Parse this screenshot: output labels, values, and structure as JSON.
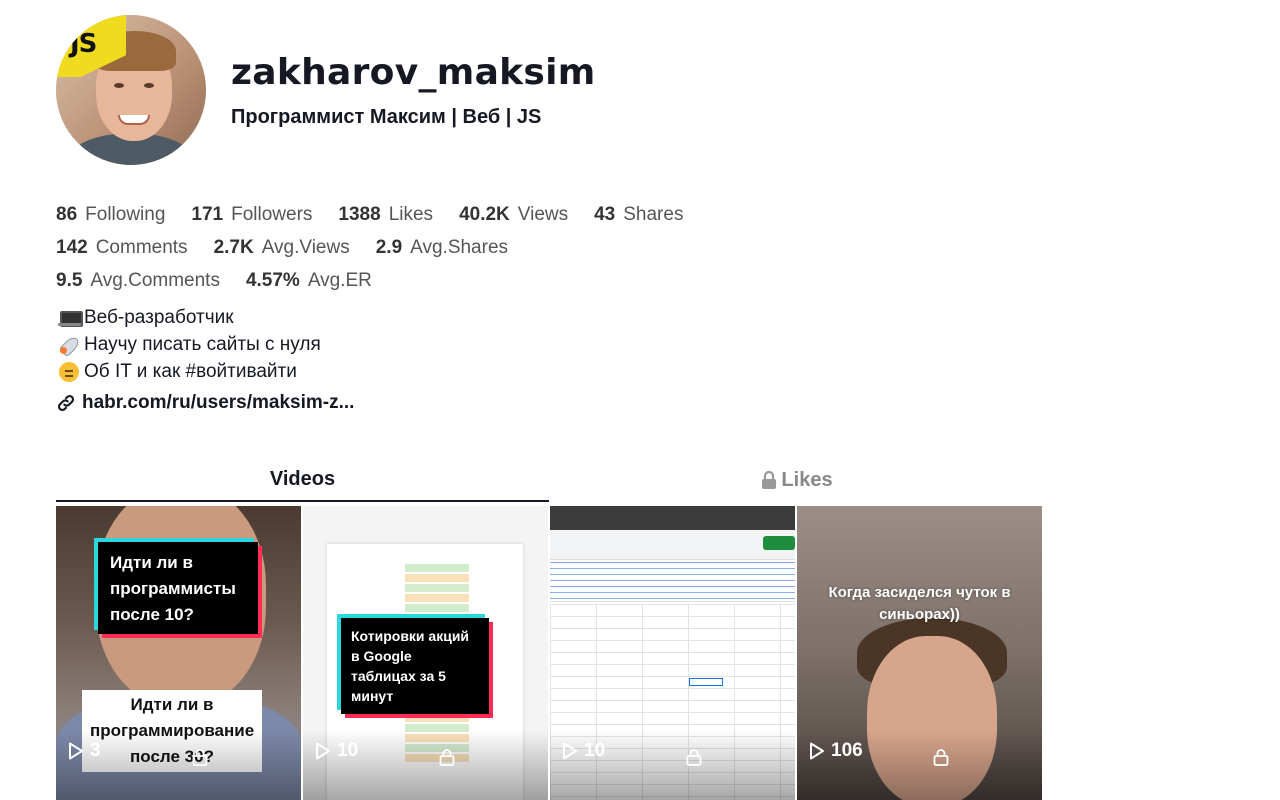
{
  "profile": {
    "username": "zakharov_maksim",
    "nickname": "Программист Максим | Веб | JS",
    "avatar_badge": "JS",
    "accent_color": "#f0db1e"
  },
  "stats": {
    "row1": [
      {
        "value": "86",
        "label": "Following"
      },
      {
        "value": "171",
        "label": "Followers"
      },
      {
        "value": "1388",
        "label": "Likes"
      },
      {
        "value": "40.2K",
        "label": "Views"
      },
      {
        "value": "43",
        "label": "Shares"
      }
    ],
    "row2": [
      {
        "value": "142",
        "label": "Comments"
      },
      {
        "value": "2.7K",
        "label": "Avg.Views"
      },
      {
        "value": "2.9",
        "label": "Avg.Shares"
      }
    ],
    "row3": [
      {
        "value": "9.5",
        "label": "Avg.Comments"
      },
      {
        "value": "4.57%",
        "label": "Avg.ER"
      }
    ]
  },
  "bio": {
    "lines": [
      {
        "icon": "laptop-icon",
        "text": "Веб-разработчик"
      },
      {
        "icon": "rocket-icon",
        "text": "Научу писать сайты с нуля"
      },
      {
        "icon": "thinking-face-icon",
        "text": "Об IT и как #войтивайти"
      }
    ],
    "link": "habr.com/ru/users/maksim-z..."
  },
  "tabs": {
    "videos": "Videos",
    "likes": "Likes"
  },
  "videos": [
    {
      "title": "Идти ли в программисты после 10?",
      "subtitle": "Идти ли в программирование после 30?",
      "plays": "3"
    },
    {
      "title": "Котировки акций в Google таблицах за 5 минут",
      "plays": "10"
    },
    {
      "plays": "10"
    },
    {
      "title": "Когда засиделся чуток в синьорах))",
      "plays": "106"
    }
  ]
}
